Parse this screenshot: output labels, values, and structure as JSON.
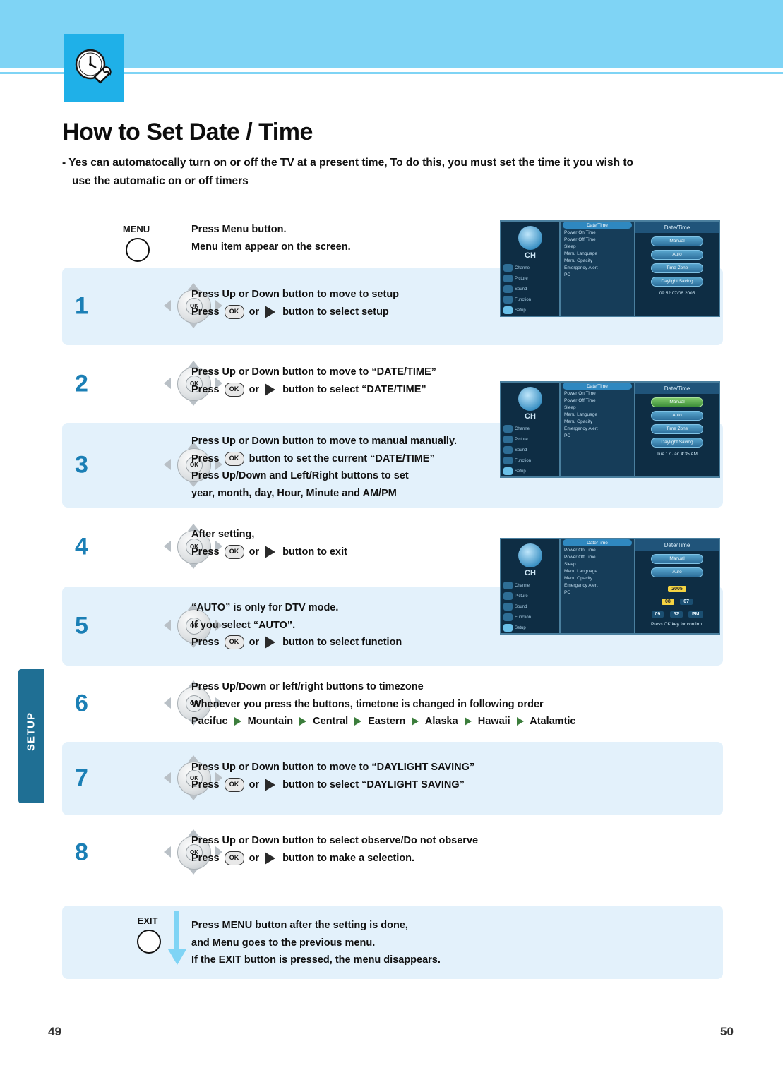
{
  "header": {
    "icon": "clock-wrench-icon",
    "title": "How to Set Date / Time",
    "subtitle_line1": "- Yes can automatocally turn on or off the TV at a present time, To do this, you must set the time it you wish to",
    "subtitle_line2": "use the automatic on or off timers"
  },
  "side_tab": {
    "label": "SETUP"
  },
  "steps": [
    {
      "num": "",
      "control_label": "MENU",
      "control": "round-button",
      "lines": [
        "Press Menu button.",
        "Menu item appear on the screen."
      ]
    },
    {
      "num": "1",
      "control": "dpad",
      "lines": [
        "Press Up or Down button to move to setup",
        "Press  OK  or  ▶  button to select setup"
      ],
      "line1": "Press Up or Down button to move to setup",
      "line2_pre": "Press",
      "line2_mid": "or",
      "line2_post": "button to select setup"
    },
    {
      "num": "2",
      "control": "dpad",
      "line1": "Press Up or Down button to move to “DATE/TIME”",
      "line2_pre": "Press",
      "line2_mid": "or",
      "line2_post": "button to select “DATE/TIME”"
    },
    {
      "num": "3",
      "control": "dpad",
      "line1": "Press Up or Down button to move to manual manually.",
      "line2_pre": "Press",
      "line2_mid": "",
      "line2_post": "button to set the current “DATE/TIME”",
      "line3": "Press Up/Down and Left/Right buttons to set",
      "line4": "year, month, day, Hour, Minute and AM/PM"
    },
    {
      "num": "4",
      "control": "dpad",
      "line1": "After setting,",
      "line2_pre": "Press",
      "line2_mid": "or",
      "line2_post": "button to exit"
    },
    {
      "num": "5",
      "control": "dpad",
      "line1": "“AUTO” is only for DTV mode.",
      "line1b": "If you select “AUTO”.",
      "line2_pre": "Press",
      "line2_mid": "or",
      "line2_post": "button to select function"
    },
    {
      "num": "6",
      "control": "dpad",
      "line1": "Press Up/Down or  left/right buttons to timezone",
      "line2": "Whenever you press the buttons, timetone is changed in following order",
      "timezones": [
        "Pacifuc",
        "Mountain",
        "Central",
        "Eastern",
        "Alaska",
        "Hawaii",
        "Atalamtic"
      ]
    },
    {
      "num": "7",
      "control": "dpad",
      "line1": "Press Up or Down button to move to “DAYLIGHT SAVING”",
      "line2_pre": "Press",
      "line2_mid": "or",
      "line2_post": "button to select “DAYLIGHT SAVING”"
    },
    {
      "num": "8",
      "control": "dpad",
      "line1": "Press Up or Down button to select observe/Do not observe",
      "line2_pre": "Press",
      "line2_mid": "or",
      "line2_post": "button to make a selection."
    },
    {
      "num": "",
      "control_label": "EXIT",
      "control": "round-button",
      "lines": [
        "Press MENU button after the setting is done,",
        "and Menu goes to the previous menu.",
        "If the EXIT button is pressed, the menu disappears."
      ]
    }
  ],
  "osd": {
    "sidebar_items": [
      "Channel",
      "Picture",
      "Sound",
      "Function",
      "Setup"
    ],
    "menu_title": "Date/Time",
    "menu_items": [
      "Date/Time",
      "Power On Time",
      "Power Off Time",
      "Sleep",
      "Menu Language",
      "Menu Opacity",
      "Emergency Alert",
      "PC"
    ],
    "panel_title": "Date/Time",
    "buttons": {
      "manual": "Manual",
      "auto": "Auto",
      "timezone": "Time Zone",
      "daylight": "Daylight Saving"
    },
    "screen1_time": "09:52   07/08   2005",
    "screen3_time": "Tue 17 Jan 4:35 AM",
    "screen4_fields": {
      "year": "2005",
      "month": "08",
      "day": "07",
      "hour": "09",
      "minute": "52",
      "ampm": "PM"
    },
    "screen4_hint": "Press  OK  key for confirm."
  },
  "footer": {
    "page_left": "49",
    "page_right": "50"
  },
  "colors": {
    "band": "#7fd4f5",
    "accent": "#1fb0e8",
    "shade": "#e3f1fb",
    "tab": "#1f6f94"
  }
}
